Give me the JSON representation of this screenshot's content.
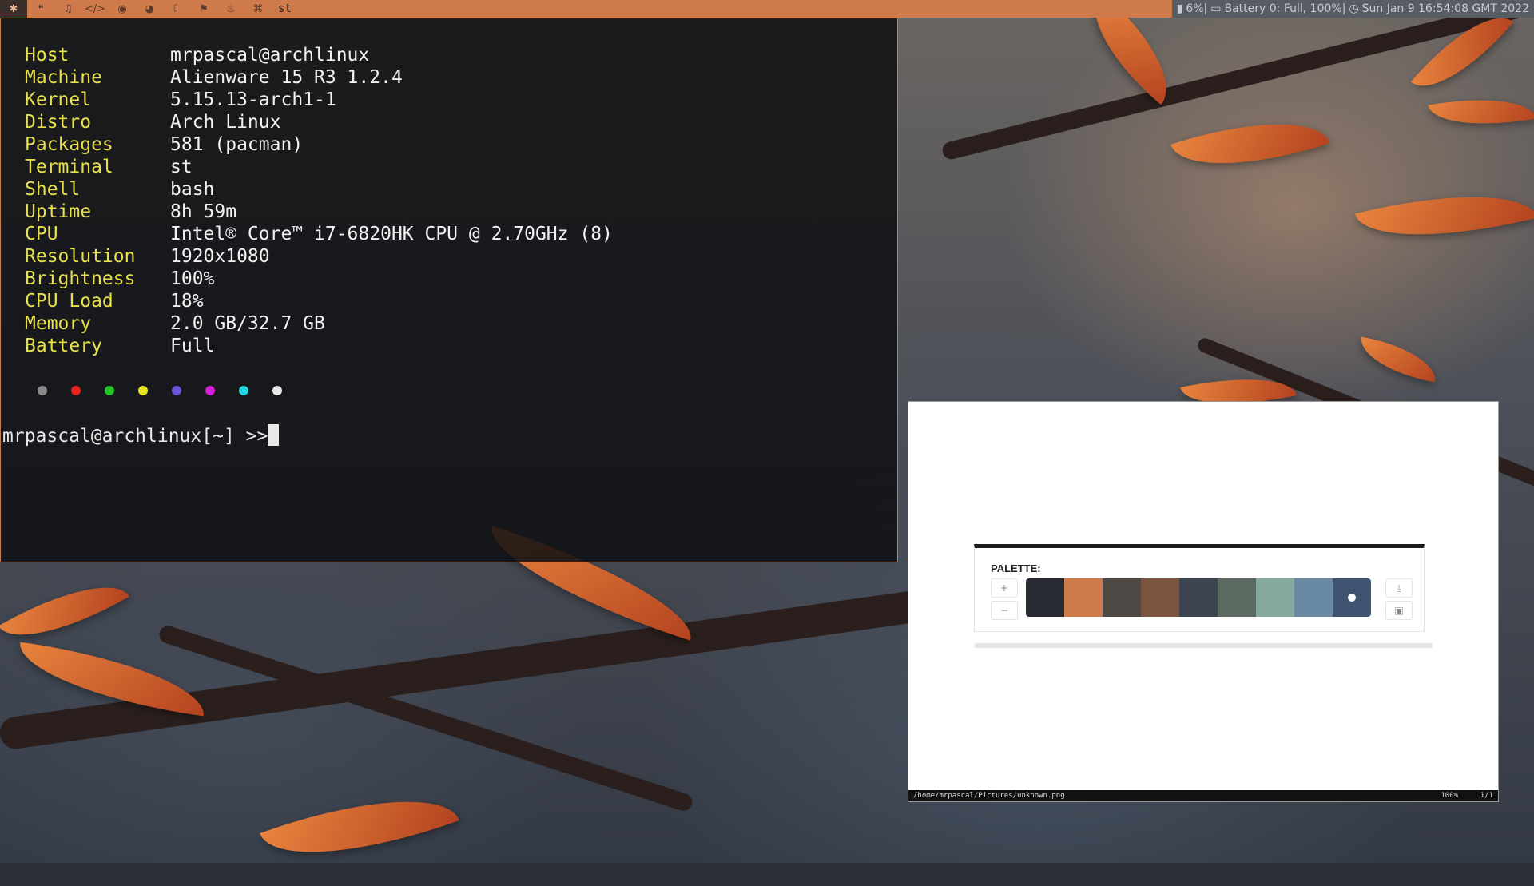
{
  "topbar": {
    "workspaces": [
      {
        "icon": "bug-icon",
        "glyph": "✱",
        "active": true
      },
      {
        "icon": "chat-icon",
        "glyph": "❝"
      },
      {
        "icon": "music-icon",
        "glyph": "♫"
      },
      {
        "icon": "code-icon",
        "glyph": "</>"
      },
      {
        "icon": "github-icon",
        "glyph": "◉"
      },
      {
        "icon": "discord-icon",
        "glyph": "◕"
      },
      {
        "icon": "moon-icon",
        "glyph": "☾"
      },
      {
        "icon": "flag-icon",
        "glyph": "⚑"
      },
      {
        "icon": "flame-icon",
        "glyph": "♨"
      },
      {
        "icon": "gamepad-icon",
        "glyph": "⌘"
      }
    ],
    "window_title": "st",
    "status": {
      "volume_icon": "volume-icon",
      "volume": "6%|",
      "battery_icon": "battery-icon",
      "battery": "Battery 0: Full, 100%|",
      "clock_icon": "clock-icon",
      "datetime": "Sun Jan  9 16:54:08 GMT 2022"
    }
  },
  "terminal": {
    "info": [
      {
        "key": "Host",
        "value": "mrpascal@archlinux"
      },
      {
        "key": "Machine",
        "value": "Alienware 15 R3 1.2.4"
      },
      {
        "key": "Kernel",
        "value": "5.15.13-arch1-1"
      },
      {
        "key": "Distro",
        "value": "Arch Linux"
      },
      {
        "key": "Packages",
        "value": "581 (pacman)"
      },
      {
        "key": "Terminal",
        "value": "st"
      },
      {
        "key": "Shell",
        "value": "bash"
      },
      {
        "key": "Uptime",
        "value": "8h 59m"
      },
      {
        "key": "CPU",
        "value": "Intel® Core™ i7-6820HK CPU @ 2.70GHz (8)"
      },
      {
        "key": "Resolution",
        "value": "1920x1080"
      },
      {
        "key": "Brightness",
        "value": "100%"
      },
      {
        "key": "CPU Load",
        "value": "18%"
      },
      {
        "key": "Memory",
        "value": "2.0 GB/32.7 GB"
      },
      {
        "key": "Battery",
        "value": "Full"
      }
    ],
    "color_dots": [
      "#8a8a8a",
      "#e8231f",
      "#23c32b",
      "#e8e21f",
      "#6a55d8",
      "#d61fd6",
      "#1fd6e0",
      "#e8e8e8"
    ],
    "prompt": "mrpascal@archlinux[~] >>"
  },
  "viewer": {
    "palette_title": "PALETTE:",
    "add_label": "+",
    "remove_label": "−",
    "download_icon": "download-icon",
    "save_icon": "save-icon",
    "swatches": [
      "#272a31",
      "#cf7a4a",
      "#4f4945",
      "#7b5540",
      "#3d4552",
      "#5a6a60",
      "#86a99e",
      "#6a8aa3",
      "#3f5270"
    ],
    "selected_index": 8,
    "path": "/home/mrpascal/Pictures/unknown.png",
    "zoom": "100%",
    "page": "1/1"
  }
}
